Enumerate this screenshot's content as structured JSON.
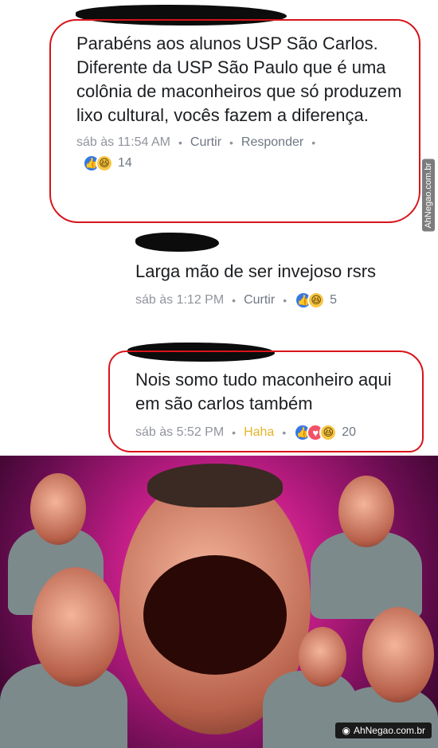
{
  "comments": [
    {
      "text": "Parabéns aos alunos USP São Carlos. Diferente da USP São Paulo que é uma colônia de maconheiros que só produzem lixo cultural,  vocês fazem a diferença.",
      "time": "sáb às 11:54 AM",
      "actions": [
        "Curtir",
        "Responder"
      ],
      "reactions": [
        "like-icon",
        "haha-icon"
      ],
      "count": "14"
    },
    {
      "text": "Larga mão de ser invejoso rsrs",
      "time": "sáb às 1:12 PM",
      "actions": [
        "Curtir"
      ],
      "reactions": [
        "like-icon",
        "haha-icon"
      ],
      "count": "5"
    },
    {
      "text": "Nois somo tudo maconheiro aqui em são carlos também",
      "time": "sáb às 5:52 PM",
      "actions": [
        "Haha"
      ],
      "reactions": [
        "like-icon",
        "love-icon",
        "haha-icon"
      ],
      "count": "20"
    }
  ],
  "separator": "•",
  "watermark_side": "AhNegao.com.br",
  "watermark_bottom": "AhNegao.com.br",
  "colors": {
    "annotation": "#d8141b",
    "like": "#3578e5",
    "love": "#f25268",
    "haha": "#f7c744",
    "haha_text": "#e2b52a"
  },
  "meme": {
    "description_icon": "laughing-man-collage-image"
  }
}
